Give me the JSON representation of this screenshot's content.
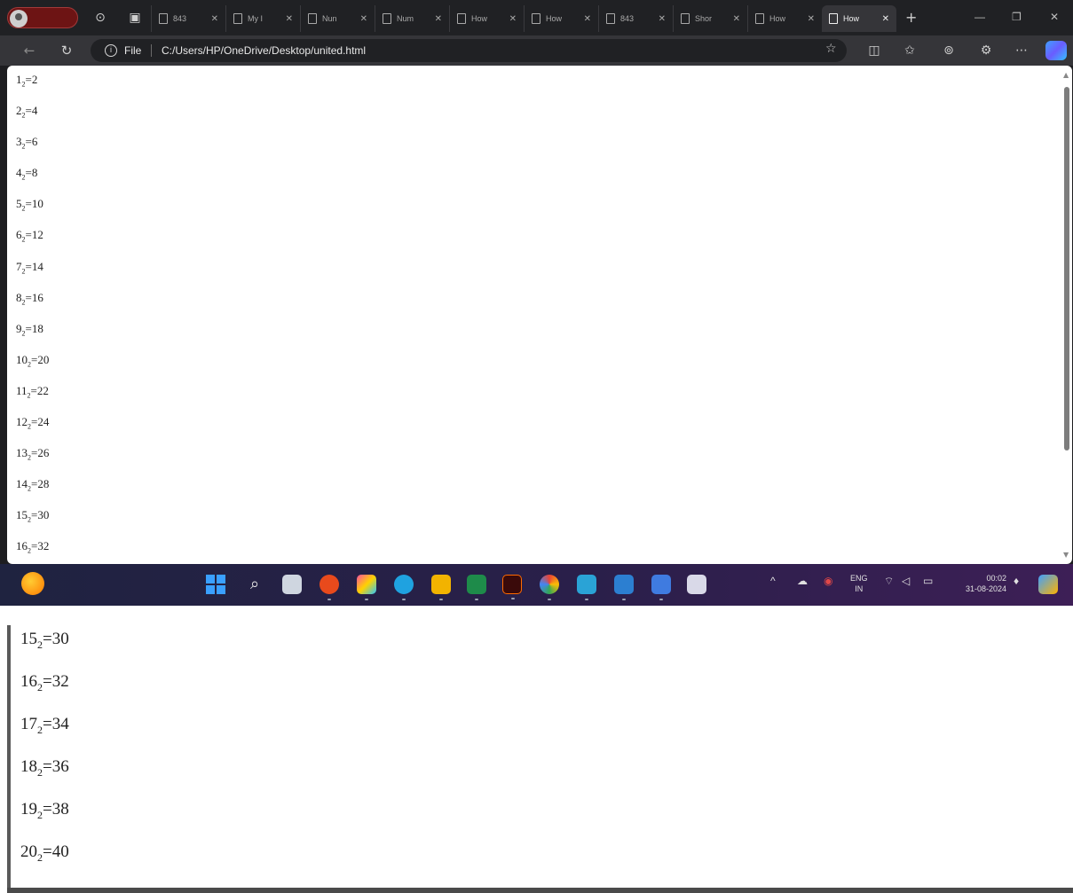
{
  "browser": {
    "profile_label": "",
    "tabs": [
      {
        "title": "843"
      },
      {
        "title": "My I"
      },
      {
        "title": "Nun"
      },
      {
        "title": "Num"
      },
      {
        "title": "How"
      },
      {
        "title": "How"
      },
      {
        "title": "843"
      },
      {
        "title": "Shor"
      },
      {
        "title": "How"
      },
      {
        "title": "How",
        "active": true
      }
    ],
    "address": {
      "scheme_label": "File",
      "url": "C:/Users/HP/OneDrive/Desktop/united.html"
    }
  },
  "page": {
    "rows": [
      {
        "base": "1",
        "sub": "2",
        "value": "=2"
      },
      {
        "base": "2",
        "sub": "2",
        "value": "=4"
      },
      {
        "base": "3",
        "sub": "2",
        "value": "=6"
      },
      {
        "base": "4",
        "sub": "2",
        "value": "=8"
      },
      {
        "base": "5",
        "sub": "2",
        "value": "=10"
      },
      {
        "base": "6",
        "sub": "2",
        "value": "=12"
      },
      {
        "base": "7",
        "sub": "2",
        "value": "=14"
      },
      {
        "base": "8",
        "sub": "2",
        "value": "=16"
      },
      {
        "base": "9",
        "sub": "2",
        "value": "=18"
      },
      {
        "base": "10",
        "sub": "2",
        "value": "=20"
      },
      {
        "base": "11",
        "sub": "2",
        "value": "=22"
      },
      {
        "base": "12",
        "sub": "2",
        "value": "=24"
      },
      {
        "base": "13",
        "sub": "2",
        "value": "=26"
      },
      {
        "base": "14",
        "sub": "2",
        "value": "=28"
      },
      {
        "base": "15",
        "sub": "2",
        "value": "=30"
      },
      {
        "base": "16",
        "sub": "2",
        "value": "=32"
      }
    ]
  },
  "taskbar": {
    "language": {
      "line1": "ENG",
      "line2": "IN"
    },
    "clock": {
      "time": "00:02",
      "date": "31-08-2024"
    }
  },
  "zoomed": {
    "rows": [
      {
        "base": "15",
        "sub": "2",
        "value": "=30"
      },
      {
        "base": "16",
        "sub": "2",
        "value": "=32"
      },
      {
        "base": "17",
        "sub": "2",
        "value": "=34"
      },
      {
        "base": "18",
        "sub": "2",
        "value": "=36"
      },
      {
        "base": "19",
        "sub": "2",
        "value": "=38"
      },
      {
        "base": "20",
        "sub": "2",
        "value": "=40"
      }
    ]
  }
}
